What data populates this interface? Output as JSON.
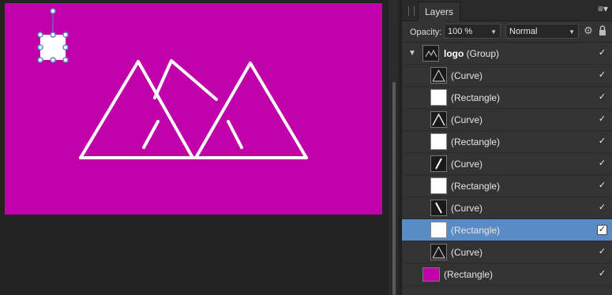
{
  "panel": {
    "tab_label": "Layers",
    "menu_icon": "hamburger-menu-icon",
    "opacity_label": "Opacity:",
    "opacity_value": "100 %",
    "blend_mode": "Normal"
  },
  "colors": {
    "artboard": "#c000a8",
    "selection": "#5b8bc5",
    "panel_bg": "#333333"
  },
  "layers": {
    "group": {
      "name": "logo",
      "kind": "(Group)",
      "visible": true
    },
    "items": [
      {
        "label": "(Curve)",
        "visible": true
      },
      {
        "label": "(Rectangle)",
        "visible": true
      },
      {
        "label": "(Curve)",
        "visible": true
      },
      {
        "label": "(Rectangle)",
        "visible": true
      },
      {
        "label": "(Curve)",
        "visible": true
      },
      {
        "label": "(Rectangle)",
        "visible": true
      },
      {
        "label": "(Curve)",
        "visible": true
      },
      {
        "label": "(Rectangle)",
        "visible": true,
        "selected": true
      },
      {
        "label": "(Curve)",
        "visible": true
      }
    ],
    "background": {
      "label": "(Rectangle)",
      "visible": true
    }
  }
}
